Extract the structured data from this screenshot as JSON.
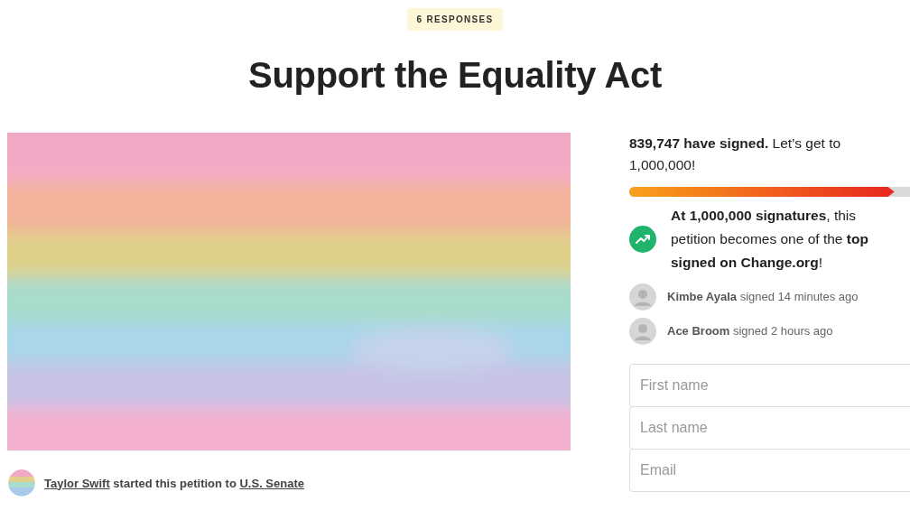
{
  "badge": "6 RESPONSES",
  "title": "Support the Equality Act",
  "starter": {
    "name": "Taylor Swift",
    "text": "started this petition to",
    "target": "U.S. Senate"
  },
  "progress": {
    "summary": "**839,747 have signed.** Let’s get to 1,000,000!",
    "level": 0.89
  },
  "milestone": "**At 1,000,000 signatures**, this petition becomes one of the **top signed on Change.org**!",
  "signers": [
    {
      "text": "**Kimbe Ayala** signed 14 minutes ago"
    },
    {
      "text": "**Ace Broom** signed 2 hours ago"
    }
  ],
  "form": {
    "fields": [
      {
        "placeholder": "First name"
      },
      {
        "placeholder": "Last name"
      },
      {
        "placeholder": "Email"
      }
    ]
  }
}
